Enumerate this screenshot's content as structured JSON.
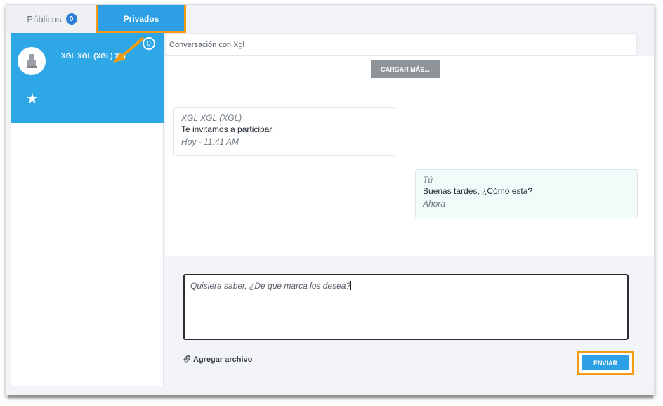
{
  "tabs": {
    "publicos_label": "Públicos",
    "publicos_count": "0",
    "privados_label": "Privados"
  },
  "sidebar": {
    "conversation": {
      "name": "XGL XGL (XGL) Xgl",
      "unread": "0",
      "favorite_icon": "star-icon",
      "avatar_icon": "user-placeholder-icon"
    }
  },
  "main": {
    "header_title": "Conversación con Xgl",
    "load_more_label": "CARGAR MÁS...",
    "messages": [
      {
        "sender": "XGL XGL (XGL)",
        "text": "Te invitamos a participar",
        "time": "Hoy - 11:41 AM"
      },
      {
        "sender": "Tú",
        "text": "Buenas tardes, ¿Cómo esta?",
        "time": "Ahora"
      }
    ]
  },
  "composer": {
    "value": "Quisiera saber, ¿De que marca los desea?",
    "attach_label": "Agregar archivo",
    "send_label": "ENVIAR"
  },
  "colors": {
    "accent_blue": "#2d9fe6",
    "highlight_orange": "#f39c12",
    "outgoing_bubble": "#f1fbf9"
  }
}
